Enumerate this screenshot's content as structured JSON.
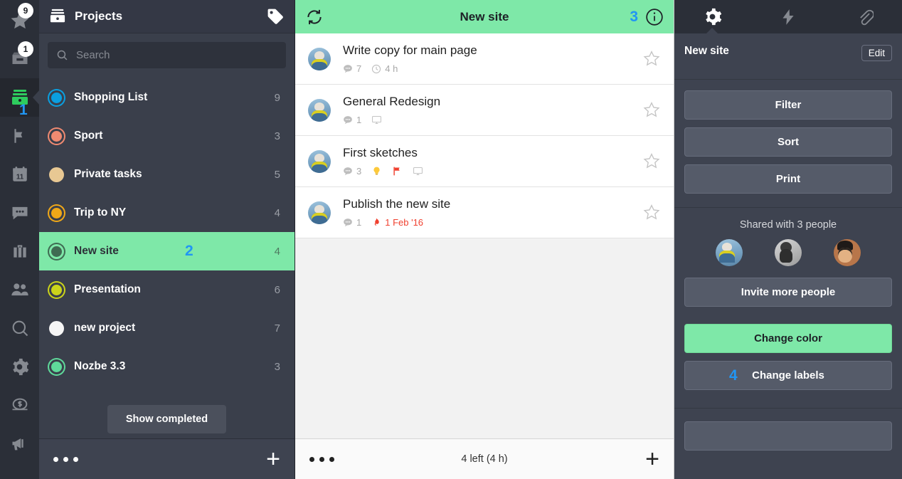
{
  "rail": {
    "items": [
      {
        "name": "priority-star",
        "badge": "9"
      },
      {
        "name": "inbox",
        "badge": "1"
      },
      {
        "name": "projects",
        "badge": null,
        "marker": "1"
      },
      {
        "name": "flag",
        "badge": null
      },
      {
        "name": "calendar",
        "badge": null,
        "day": "11"
      },
      {
        "name": "comments",
        "badge": null
      },
      {
        "name": "briefcase",
        "badge": null
      },
      {
        "name": "team",
        "badge": null
      },
      {
        "name": "search",
        "badge": null
      },
      {
        "name": "settings",
        "badge": null
      },
      {
        "name": "billing",
        "badge": null
      },
      {
        "name": "announcements",
        "badge": null
      }
    ]
  },
  "projects_panel": {
    "header_title": "Projects",
    "search": {
      "placeholder": "Search",
      "value": ""
    },
    "items": [
      {
        "name": "Shopping List",
        "count": "9",
        "color": "#0a9fe0",
        "style": "ring",
        "selected": false
      },
      {
        "name": "Sport",
        "count": "3",
        "color": "#f08a71",
        "style": "ring",
        "selected": false
      },
      {
        "name": "Private tasks",
        "count": "5",
        "color": "#e8c893",
        "style": "solid",
        "selected": false
      },
      {
        "name": "Trip to NY",
        "count": "4",
        "color": "#f0a818",
        "style": "ring",
        "selected": false
      },
      {
        "name": "New site",
        "count": "4",
        "color": "#3f6b52",
        "style": "ring",
        "selected": true,
        "marker": "2"
      },
      {
        "name": "Presentation",
        "count": "6",
        "color": "#cbd41a",
        "style": "ring",
        "selected": false
      },
      {
        "name": "new project",
        "count": "7",
        "color": "#f5f5f5",
        "style": "solid",
        "selected": false
      },
      {
        "name": "Nozbe 3.3",
        "count": "3",
        "color": "#5fd99a",
        "style": "ring",
        "selected": false
      }
    ],
    "show_completed_label": "Show completed",
    "footer": {
      "more_label": "more-options",
      "add_label": "+"
    }
  },
  "tasks_panel": {
    "header_title": "New site",
    "header_marker": "3",
    "tasks": [
      {
        "title": "Write copy for main page",
        "avatar": "a1",
        "comments": "7",
        "time": "4 h",
        "icons": [
          "comment",
          "clock"
        ],
        "starred": false
      },
      {
        "title": "General Redesign",
        "avatar": "a1",
        "comments": "1",
        "time": "",
        "icons": [
          "comment",
          "monitor"
        ],
        "starred": false
      },
      {
        "title": "First sketches",
        "avatar": "a1",
        "comments": "3",
        "time": "",
        "icons": [
          "comment",
          "bulb",
          "flag",
          "monitor"
        ],
        "starred": false
      },
      {
        "title": "Publish the new site",
        "avatar": "a1",
        "comments": "1",
        "date": "1 Feb '16",
        "icons": [
          "comment",
          "fire"
        ],
        "starred": false
      }
    ],
    "footer_label": "4 left (4 h)"
  },
  "detail_panel": {
    "tabs": [
      {
        "name": "settings-gear",
        "active": true
      },
      {
        "name": "lightning-bolt",
        "active": false
      },
      {
        "name": "paperclip",
        "active": false
      }
    ],
    "title": "New site",
    "edit_label": "Edit",
    "buttons": [
      {
        "label": "Filter",
        "variant": "default"
      },
      {
        "label": "Sort",
        "variant": "default"
      },
      {
        "label": "Print",
        "variant": "default"
      }
    ],
    "share_label": "Shared with 3 people",
    "share_avatars": [
      "a1",
      "a2",
      "a3"
    ],
    "invite_label": "Invite more people",
    "change_color_label": "Change color",
    "change_labels_label": "Change labels",
    "change_labels_marker": "4"
  },
  "colors": {
    "accent_green": "#7ee8a8",
    "marker_blue": "#2196f3",
    "panel_dark": "#3e4350",
    "rail_dark": "#2b2f38",
    "due_red": "#f0402f"
  }
}
